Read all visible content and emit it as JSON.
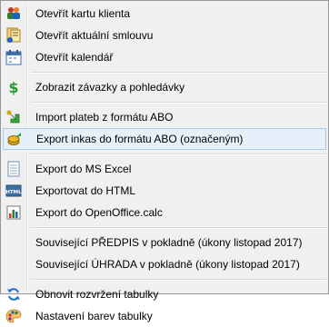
{
  "menu": {
    "groups": [
      {
        "items": [
          {
            "label": "Otevřít kartu klienta",
            "icon": "client-card-icon"
          },
          {
            "label": "Otevřít aktuální smlouvu",
            "icon": "contract-icon"
          },
          {
            "label": "Otevřít kalendář",
            "icon": "calendar-icon"
          }
        ]
      },
      {
        "items": [
          {
            "label": "Zobrazit závazky a pohledávky",
            "icon": "dollar-icon"
          }
        ]
      },
      {
        "items": [
          {
            "label": "Import plateb z formátu ABO",
            "icon": "import-arrow-icon"
          },
          {
            "label": "Export inkas do formátu ABO (označeným)",
            "icon": "export-coins-icon",
            "highlighted": true
          }
        ]
      },
      {
        "items": [
          {
            "label": "Export do MS Excel",
            "icon": "excel-icon"
          },
          {
            "label": "Exportovat do HTML",
            "icon": "html-icon"
          },
          {
            "label": "Export do OpenOffice.calc",
            "icon": "calc-chart-icon"
          }
        ]
      },
      {
        "items": [
          {
            "label": "Související PŘEDPIS v pokladně (úkony listopad 2017)",
            "icon": ""
          },
          {
            "label": "Související ÚHRADA v pokladně (úkony listopad 2017)",
            "icon": ""
          }
        ]
      },
      {
        "items": [
          {
            "label": "Obnovit rozvržení tabulky",
            "icon": "refresh-icon"
          },
          {
            "label": "Nastavení barev tabulky",
            "icon": "color-palette-icon"
          }
        ]
      }
    ]
  }
}
